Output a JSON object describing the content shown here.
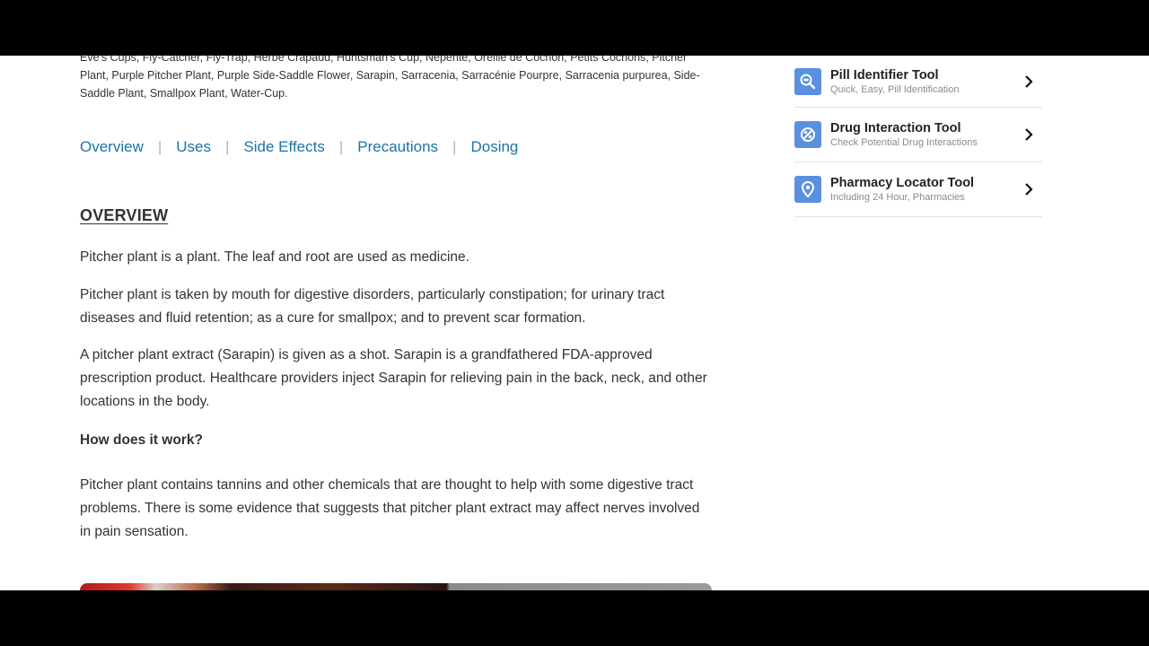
{
  "article": {
    "aliases_text": "Eve's Cups, Fly-Catcher, Fly-Trap, Herbe Crapaud, Huntsman's Cup, Nepente, Oreille de Cochon, Petits Cochons, Pitcher Plant, Purple Pitcher Plant, Purple Side-Saddle Flower, Sarapin, Sarracenia, Sarracénie Pourpre, Sarracenia purpurea, Side-Saddle Plant, Smallpox Plant, Water-Cup.",
    "tabs": [
      {
        "label": "Overview"
      },
      {
        "label": "Uses"
      },
      {
        "label": "Side Effects"
      },
      {
        "label": "Precautions"
      },
      {
        "label": "Dosing"
      }
    ],
    "tab_separator": "|",
    "section_title": "OVERVIEW",
    "paragraphs": [
      "Pitcher plant is a plant. The leaf and root are used as medicine.",
      "Pitcher plant is taken by mouth for digestive disorders, particularly constipation; for urinary tract diseases and fluid retention; as a cure for smallpox; and to prevent scar formation.",
      "A pitcher plant extract (Sarapin) is given as a shot. Sarapin is a grandfathered FDA-approved prescription product. Healthcare providers inject Sarapin for relieving pain in the back, neck, and other locations in the body."
    ],
    "subheading": "How does it work?",
    "mechanism_paragraph": "Pitcher plant contains tannins and other chemicals that are thought to help with some digestive tract problems. There is some evidence that suggests that pitcher plant extract may affect nerves involved in pain sensation."
  },
  "sidebar": {
    "tools": [
      {
        "title": "Pill Identifier Tool",
        "subtitle": "Quick, Easy, Pill Identification",
        "icon": "pill-search-icon"
      },
      {
        "title": "Drug Interaction Tool",
        "subtitle": "Check Potential Drug Interactions",
        "icon": "interaction-icon"
      },
      {
        "title": "Pharmacy Locator Tool",
        "subtitle": "Including 24 Hour, Pharmacies",
        "icon": "location-pin-icon"
      }
    ]
  },
  "colors": {
    "link": "#1a73a8",
    "tool_icon_bg": "#5b8fe0",
    "text": "#333333",
    "muted": "#8a8a8a"
  }
}
